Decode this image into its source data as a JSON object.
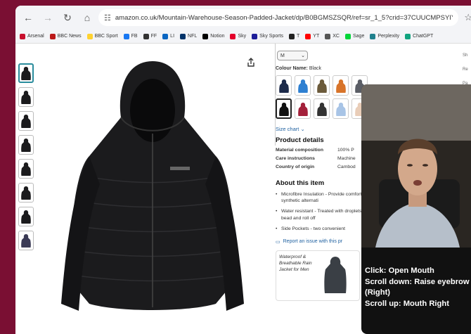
{
  "browser": {
    "url": "amazon.co.uk/Mountain-Warehouse-Season-Padded-Jacket/dp/B0BGMSZSQR/ref=sr_1_5?crid=37CUUCMPSYIY1&dib=eyJ...",
    "bookmarks": [
      {
        "label": "Arsenal",
        "color": "#c8102e"
      },
      {
        "label": "BBC News",
        "color": "#bb1919"
      },
      {
        "label": "BBC Sport",
        "color": "#ffd230"
      },
      {
        "label": "FB",
        "color": "#1877f2"
      },
      {
        "label": "FF",
        "color": "#333333"
      },
      {
        "label": "LI",
        "color": "#0a66c2"
      },
      {
        "label": "NFL",
        "color": "#013369"
      },
      {
        "label": "Notion",
        "color": "#000000"
      },
      {
        "label": "Sky",
        "color": "#e4002b"
      },
      {
        "label": "Sky Sports",
        "color": "#1d1d99"
      },
      {
        "label": "T",
        "color": "#222222"
      },
      {
        "label": "YT",
        "color": "#ff0000"
      },
      {
        "label": "XC",
        "color": "#555555"
      },
      {
        "label": "Sage",
        "color": "#00d639"
      },
      {
        "label": "Perplexity",
        "color": "#20808d"
      },
      {
        "label": "ChatGPT",
        "color": "#10a37f"
      }
    ]
  },
  "product": {
    "size_value": "M",
    "colour_label": "Colour Name:",
    "colour_value": "Black",
    "swatch_colors": [
      "#1c2a4a",
      "#2d7fd1",
      "#6b5a3a",
      "#d8742a",
      "#5b5e66",
      "#111111",
      "#a3203a",
      "#333333",
      "#a8c4e6",
      "#e9cdb8"
    ],
    "size_chart": "Size chart",
    "details_heading": "Product details",
    "details": [
      {
        "key": "Material composition",
        "value": "100% P"
      },
      {
        "key": "Care instructions",
        "value": "Machine"
      },
      {
        "key": "Country of origin",
        "value": "Cambod"
      }
    ],
    "about_heading": "About this item",
    "about": [
      "Microfibre Insulation - Provide comfort, a synthetic alternati",
      "Water resistant - Treated with droplets will bead and roll off",
      "Side Pockets - two convenient"
    ],
    "report": "Report an issue with this pr",
    "card_text": "Waterproof & Breathable Rain Jacket for Men"
  },
  "farright": [
    "Sh",
    "Re",
    "Pa",
    "Se",
    "Re"
  ],
  "overlay": {
    "lines": [
      "Click: Open Mouth",
      "Scroll down: Raise eyebrow (Right)",
      "Scroll up: Mouth Right"
    ]
  }
}
